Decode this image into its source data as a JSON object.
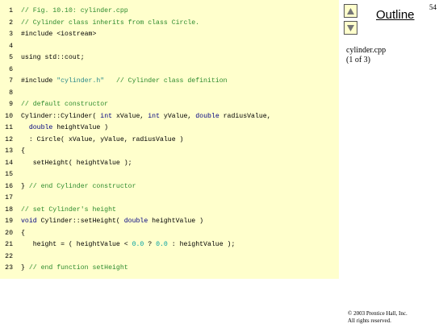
{
  "page_number": "54",
  "sidebar": {
    "outline_label": "Outline",
    "file_name": "cylinder.cpp",
    "file_part": "(1 of 3)",
    "up_icon": "triangle-up-icon",
    "down_icon": "triangle-down-icon"
  },
  "footer": {
    "copyright_line1": "© 2003 Prentice Hall, Inc.",
    "copyright_line2": "All rights reserved."
  },
  "code_lines": [
    {
      "num": "1",
      "parts": [
        {
          "t": "// Fig. 10.10: cylinder.cpp",
          "k": "c"
        }
      ]
    },
    {
      "num": "2",
      "parts": [
        {
          "t": "// Cylinder class inherits from class Circle.",
          "k": "c"
        }
      ]
    },
    {
      "num": "3",
      "parts": [
        {
          "t": "#include <iostream>",
          "k": ""
        }
      ]
    },
    {
      "num": "4",
      "parts": []
    },
    {
      "num": "5",
      "parts": [
        {
          "t": "using std::cout;",
          "k": ""
        }
      ]
    },
    {
      "num": "6",
      "parts": []
    },
    {
      "num": "7",
      "parts": [
        {
          "t": "#include ",
          "k": ""
        },
        {
          "t": "\"cylinder.h\"",
          "k": "s"
        },
        {
          "t": "   // Cylinder class definition",
          "k": "c"
        }
      ]
    },
    {
      "num": "8",
      "parts": []
    },
    {
      "num": "9",
      "parts": [
        {
          "t": "// default constructor",
          "k": "c"
        }
      ]
    },
    {
      "num": "10",
      "parts": [
        {
          "t": "Cylinder::Cylinder( ",
          "k": ""
        },
        {
          "t": "int",
          "k": "k"
        },
        {
          "t": " xValue, ",
          "k": ""
        },
        {
          "t": "int",
          "k": "k"
        },
        {
          "t": " yValue, ",
          "k": ""
        },
        {
          "t": "double",
          "k": "k"
        },
        {
          "t": " radiusValue,",
          "k": ""
        }
      ]
    },
    {
      "num": "11",
      "parts": [
        {
          "t": "  ",
          "k": ""
        },
        {
          "t": "double",
          "k": "k"
        },
        {
          "t": " heightValue )",
          "k": ""
        }
      ]
    },
    {
      "num": "12",
      "parts": [
        {
          "t": "  : Circle( xValue, yValue, radiusValue )",
          "k": ""
        }
      ]
    },
    {
      "num": "13",
      "parts": [
        {
          "t": "{",
          "k": ""
        }
      ]
    },
    {
      "num": "14",
      "parts": [
        {
          "t": "   setHeight( heightValue );",
          "k": ""
        }
      ]
    },
    {
      "num": "15",
      "parts": []
    },
    {
      "num": "16",
      "parts": [
        {
          "t": "} ",
          "k": ""
        },
        {
          "t": "// end Cylinder constructor",
          "k": "c"
        }
      ]
    },
    {
      "num": "17",
      "parts": []
    },
    {
      "num": "18",
      "parts": [
        {
          "t": "// set Cylinder's height",
          "k": "c"
        }
      ]
    },
    {
      "num": "19",
      "parts": [
        {
          "t": "void",
          "k": "k"
        },
        {
          "t": " Cylinder::setHeight( ",
          "k": ""
        },
        {
          "t": "double",
          "k": "k"
        },
        {
          "t": " heightValue )",
          "k": ""
        }
      ]
    },
    {
      "num": "20",
      "parts": [
        {
          "t": "{",
          "k": ""
        }
      ]
    },
    {
      "num": "21",
      "parts": [
        {
          "t": "   height = ( heightValue < ",
          "k": ""
        },
        {
          "t": "0.0",
          "k": "n"
        },
        {
          "t": " ? ",
          "k": ""
        },
        {
          "t": "0.0",
          "k": "n"
        },
        {
          "t": " : heightValue );",
          "k": ""
        }
      ]
    },
    {
      "num": "22",
      "parts": []
    },
    {
      "num": "23",
      "parts": [
        {
          "t": "} ",
          "k": ""
        },
        {
          "t": "// end function setHeight",
          "k": "c"
        }
      ]
    }
  ]
}
